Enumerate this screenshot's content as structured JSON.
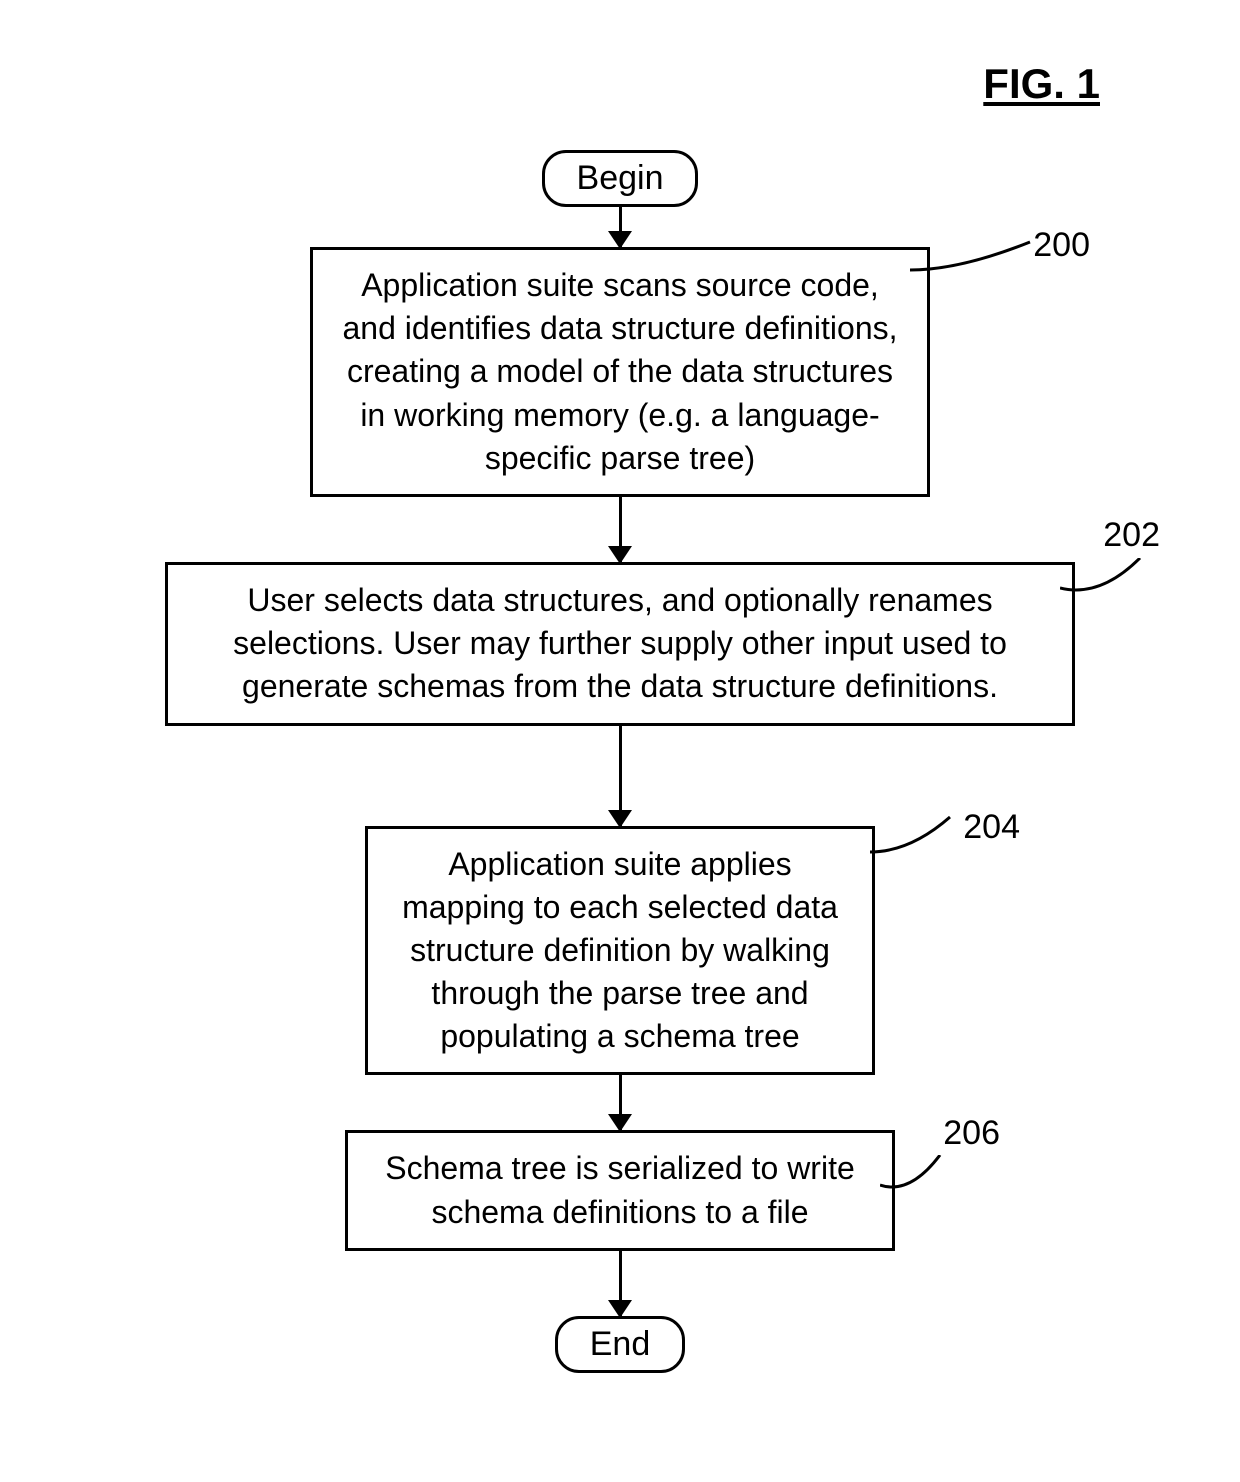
{
  "figure_title": "FIG. 1",
  "terminals": {
    "begin": "Begin",
    "end": "End"
  },
  "boxes": {
    "b200": "Application suite scans source code, and identifies data structure definitions, creating a model of the data structures in working memory (e.g. a language-specific parse tree)",
    "b202": "User selects data structures, and optionally renames selections. User may further supply other input used to generate schemas from the data structure definitions.",
    "b204": "Application suite applies mapping to each selected data structure definition by walking through the parse tree and populating a schema tree",
    "b206": "Schema tree is serialized to write schema definitions to a file"
  },
  "refs": {
    "r200": "200",
    "r202": "202",
    "r204": "204",
    "r206": "206"
  }
}
